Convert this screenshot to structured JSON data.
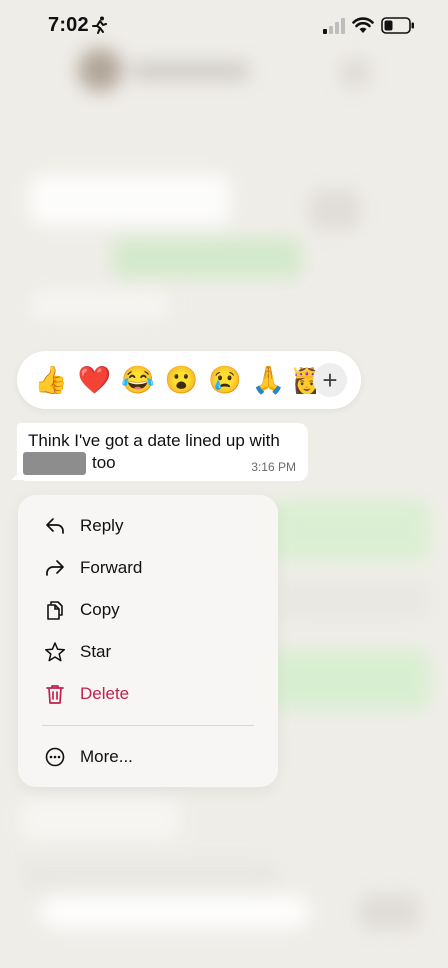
{
  "status_bar": {
    "time": "7:02",
    "activity_icon": "running-person-icon"
  },
  "reactions": {
    "emojis": [
      {
        "name": "thumbs-up",
        "glyph": "👍"
      },
      {
        "name": "red-heart",
        "glyph": "❤️"
      },
      {
        "name": "tears-of-joy",
        "glyph": "😂"
      },
      {
        "name": "surprised",
        "glyph": "😮"
      },
      {
        "name": "crying",
        "glyph": "😢"
      },
      {
        "name": "folded-hands",
        "glyph": "🙏"
      },
      {
        "name": "crown-partial",
        "glyph": "👸"
      }
    ],
    "more_label": "+"
  },
  "message": {
    "line1": "Think I've got a date lined up with",
    "line2": "too",
    "time": "3:16 PM"
  },
  "menu": {
    "items": [
      {
        "label": "Reply",
        "icon": "reply-icon"
      },
      {
        "label": "Forward",
        "icon": "forward-icon"
      },
      {
        "label": "Copy",
        "icon": "copy-icon"
      },
      {
        "label": "Star",
        "icon": "star-icon"
      },
      {
        "label": "Delete",
        "icon": "trash-icon"
      }
    ],
    "more": {
      "label": "More...",
      "icon": "more-icon"
    },
    "danger_color": "#c2204f"
  }
}
